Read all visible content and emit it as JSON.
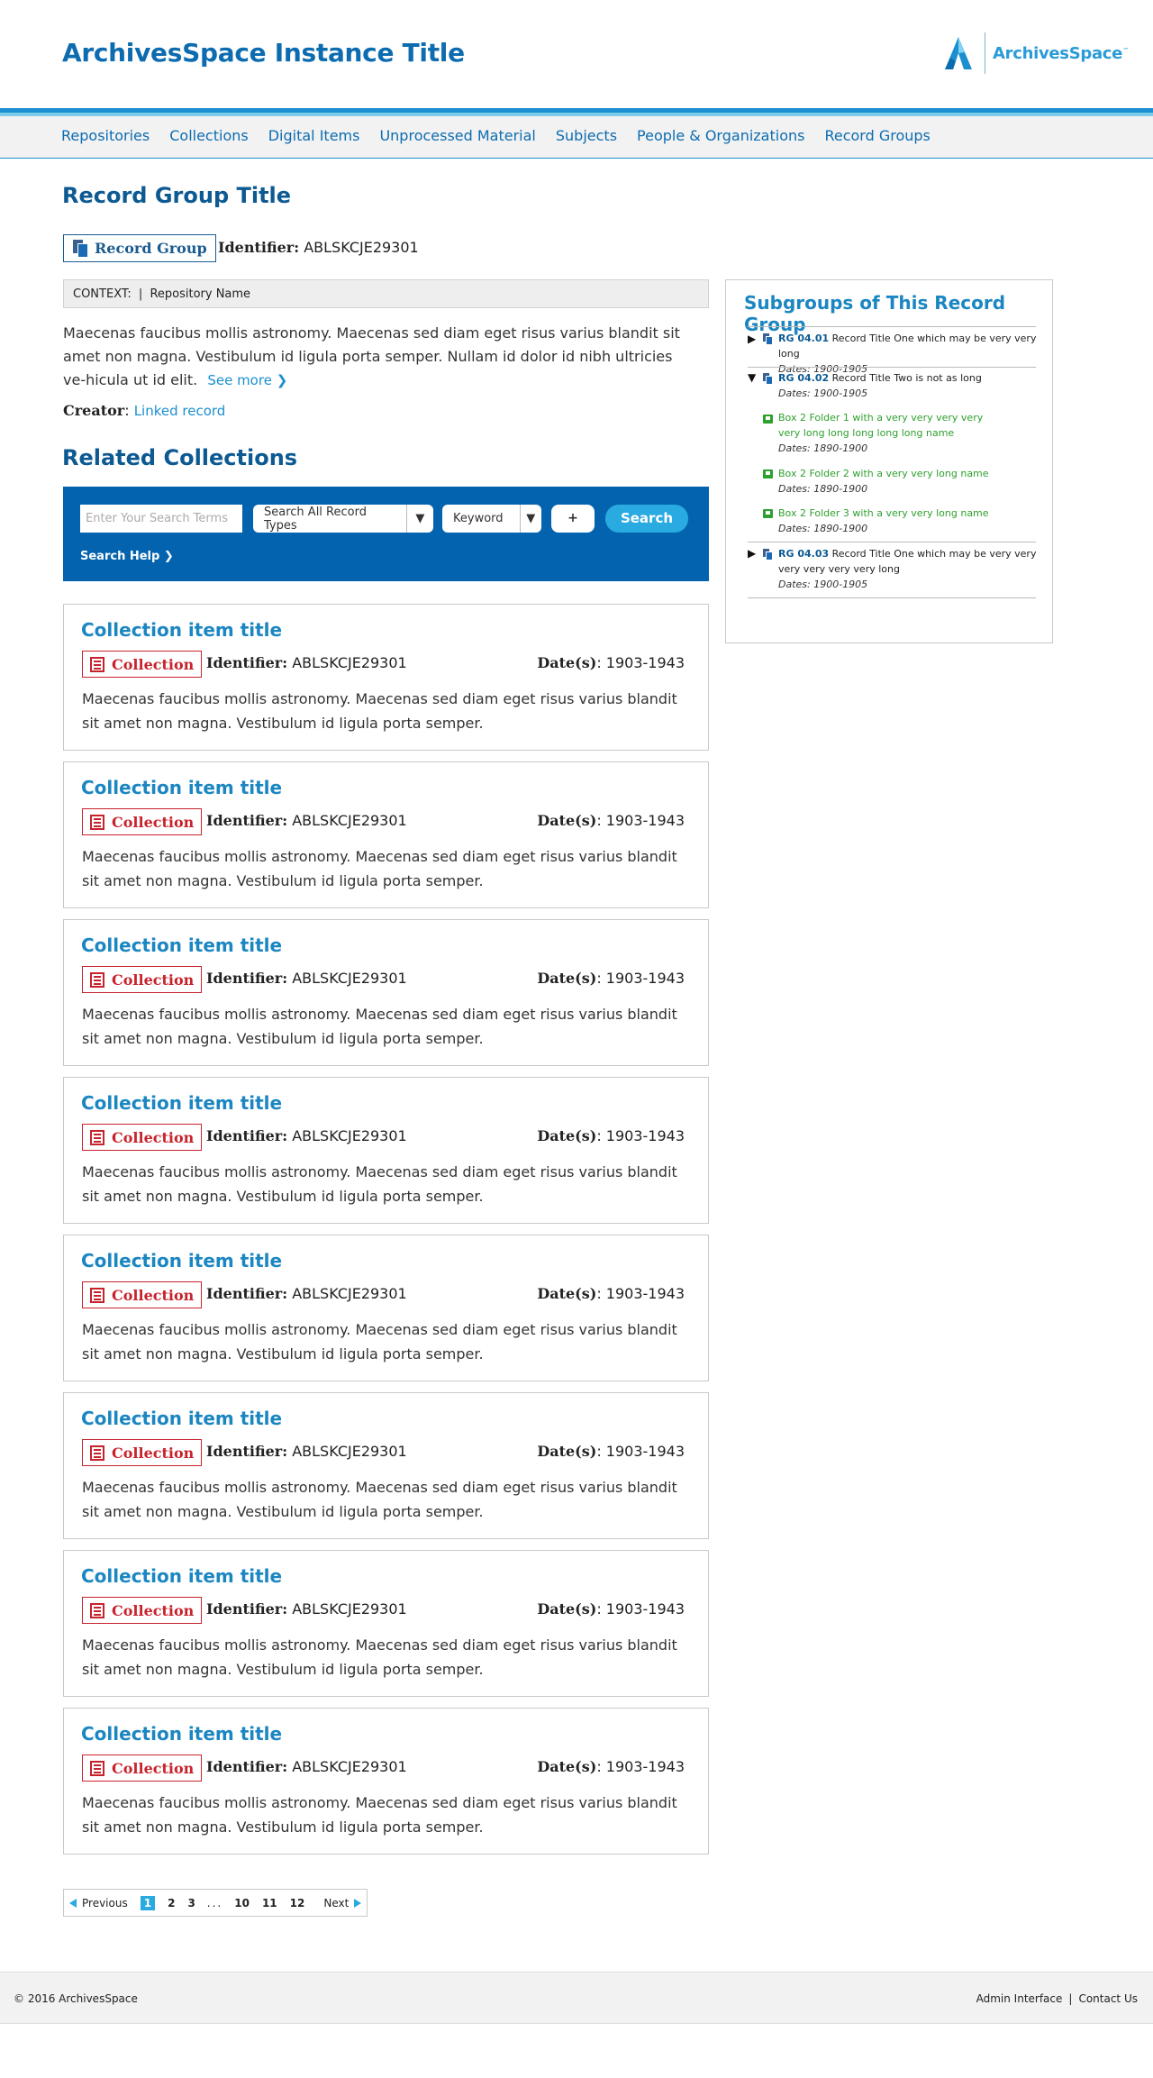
{
  "header": {
    "site_title": "ArchivesSpace Instance Title",
    "logo_text": "ArchivesSpace",
    "logo_tm": "™"
  },
  "nav": {
    "items": [
      "Repositories",
      "Collections",
      "Digital Items",
      "Unprocessed Material",
      "Subjects",
      "People & Organizations",
      "Record Groups"
    ]
  },
  "record": {
    "title": "Record Group Title",
    "type_label": "Record Group",
    "identifier_label": "Identifier:",
    "identifier": "ABLSKCJE29301",
    "context_label": "CONTEXT:",
    "context_sep": "|",
    "context_repo": "Repository Name",
    "description": "Maecenas faucibus mollis astronomy. Maecenas sed diam eget risus varius blandit sit amet non magna. Vestibulum id ligula porta semper. Nullam id dolor id nibh ultricies ve-hicula ut id elit.",
    "see_more": "See more ❯",
    "creator_label": "Creator",
    "creator_colon": ":",
    "creator_link": "Linked record"
  },
  "related": {
    "title": "Related Collections"
  },
  "search": {
    "placeholder": "Enter Your Search Terms",
    "record_types": "Search All Record Types",
    "field": "Keyword",
    "add": "+",
    "button": "Search",
    "help": "Search Help ❯"
  },
  "collections": [
    {
      "title": "Collection item title",
      "type": "Collection",
      "identifier_label": "Identifier:",
      "identifier": "ABLSKCJE29301",
      "dates_label": "Date(s)",
      "dates": ": 1903-1943",
      "description": "Maecenas faucibus mollis astronomy. Maecenas sed diam eget risus varius blandit sit amet non magna. Vestibulum id ligula porta semper."
    },
    {
      "title": "Collection item title",
      "type": "Collection",
      "identifier_label": "Identifier:",
      "identifier": "ABLSKCJE29301",
      "dates_label": "Date(s)",
      "dates": ": 1903-1943",
      "description": "Maecenas faucibus mollis astronomy. Maecenas sed diam eget risus varius blandit sit amet non magna. Vestibulum id ligula porta semper."
    },
    {
      "title": "Collection item title",
      "type": "Collection",
      "identifier_label": "Identifier:",
      "identifier": "ABLSKCJE29301",
      "dates_label": "Date(s)",
      "dates": ": 1903-1943",
      "description": "Maecenas faucibus mollis astronomy. Maecenas sed diam eget risus varius blandit sit amet non magna. Vestibulum id ligula porta semper."
    },
    {
      "title": "Collection item title",
      "type": "Collection",
      "identifier_label": "Identifier:",
      "identifier": "ABLSKCJE29301",
      "dates_label": "Date(s)",
      "dates": ": 1903-1943",
      "description": "Maecenas faucibus mollis astronomy. Maecenas sed diam eget risus varius blandit sit amet non magna. Vestibulum id ligula porta semper."
    },
    {
      "title": "Collection item title",
      "type": "Collection",
      "identifier_label": "Identifier:",
      "identifier": "ABLSKCJE29301",
      "dates_label": "Date(s)",
      "dates": ": 1903-1943",
      "description": "Maecenas faucibus mollis astronomy. Maecenas sed diam eget risus varius blandit sit amet non magna. Vestibulum id ligula porta semper."
    },
    {
      "title": "Collection item title",
      "type": "Collection",
      "identifier_label": "Identifier:",
      "identifier": "ABLSKCJE29301",
      "dates_label": "Date(s)",
      "dates": ": 1903-1943",
      "description": "Maecenas faucibus mollis astronomy. Maecenas sed diam eget risus varius blandit sit amet non magna. Vestibulum id ligula porta semper."
    },
    {
      "title": "Collection item title",
      "type": "Collection",
      "identifier_label": "Identifier:",
      "identifier": "ABLSKCJE29301",
      "dates_label": "Date(s)",
      "dates": ": 1903-1943",
      "description": "Maecenas faucibus mollis astronomy. Maecenas sed diam eget risus varius blandit sit amet non magna. Vestibulum id ligula porta semper."
    },
    {
      "title": "Collection item title",
      "type": "Collection",
      "identifier_label": "Identifier:",
      "identifier": "ABLSKCJE29301",
      "dates_label": "Date(s)",
      "dates": ": 1903-1943",
      "description": "Maecenas faucibus mollis astronomy. Maecenas sed diam eget risus varius blandit sit amet non magna. Vestibulum id ligula porta semper."
    }
  ],
  "pagination": {
    "previous": "Previous",
    "pages": [
      "1",
      "2",
      "3"
    ],
    "ellipsis": "...",
    "pages_end": [
      "10",
      "11",
      "12"
    ],
    "next": "Next",
    "current": "1"
  },
  "sidebar": {
    "title": "Subgroups of This Record Group",
    "nodes": [
      {
        "rg": "RG 04.01",
        "text": "Record Title One which may be very very long",
        "dates": "Dates: 1900-1905",
        "toggle": "▶"
      },
      {
        "rg": "RG 04.02",
        "text": "Record Title Two is not as long",
        "dates": "Dates: 1900-1905",
        "toggle": "▼"
      },
      {
        "text": "Box 2 Folder 1 with a very very very very very long long long long long name",
        "dates": "Dates: 1890-1900"
      },
      {
        "text": "Box 2 Folder 2 with a very very long name",
        "dates": "Dates: 1890-1900"
      },
      {
        "text": "Box 2 Folder 3 with a very very long name",
        "dates": "Dates: 1890-1900"
      },
      {
        "rg": "RG 04.03",
        "text": "Record Title One which may be very very very very very very long",
        "dates": "Dates: 1900-1905",
        "toggle": "▶"
      }
    ]
  },
  "footer": {
    "copyright": "© 2016 ArchivesSpace",
    "admin": "Admin Interface",
    "sep": "|",
    "contact": "Contact Us"
  }
}
